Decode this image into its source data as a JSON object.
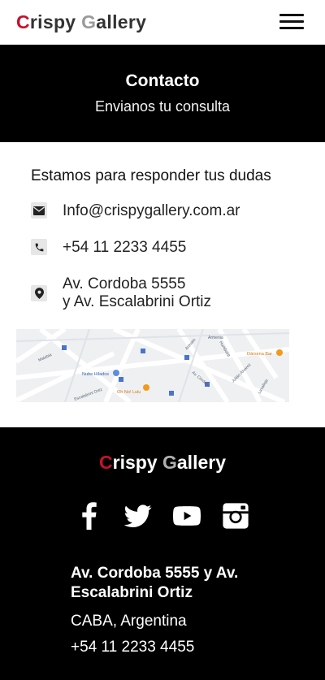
{
  "header": {
    "logo_first_letter": "C",
    "logo_part1": "rispy ",
    "logo_second_letter": "G",
    "logo_part2": "allery",
    "menu_icon": "hamburger-menu-icon"
  },
  "hero": {
    "title": "Contacto",
    "subtitle": "Envianos tu consulta"
  },
  "contact": {
    "heading": "Estamos para responder tus dudas",
    "email": "Info@crispygallery.com.ar",
    "phone": "+54 11 2233 4455",
    "address_line1": "Av. Cordoba 5555",
    "address_line2": "y Av. Escalabrini Ortiz",
    "icons": [
      "envelope-icon",
      "phone-icon",
      "map-pin-icon"
    ]
  },
  "map": {
    "place_labels": [
      "Nube Hilados",
      "Oh No! Lulu",
      "Dársena Bar",
      "Malabia",
      "Armenia",
      "Arévalo",
      "Av. Córdoba",
      "Julián Álvarez",
      "Lavalleja",
      "Escalabrini Ortiz",
      "Humboldt"
    ]
  },
  "footer": {
    "logo_first_letter": "C",
    "logo_part1": "rispy ",
    "logo_second_letter": "G",
    "logo_part2": "allery",
    "social_icons": [
      "facebook-icon",
      "twitter-icon",
      "youtube-icon",
      "instagram-icon"
    ],
    "address": "Av. Cordoba 5555 y Av. Escalabrini Ortiz",
    "city": "CABA, Argentina",
    "phone": "+54 11 2233 4455"
  },
  "colors": {
    "brand_red": "#c8102e",
    "brand_grey": "#9a9a9a",
    "dark_background": "#000000"
  }
}
